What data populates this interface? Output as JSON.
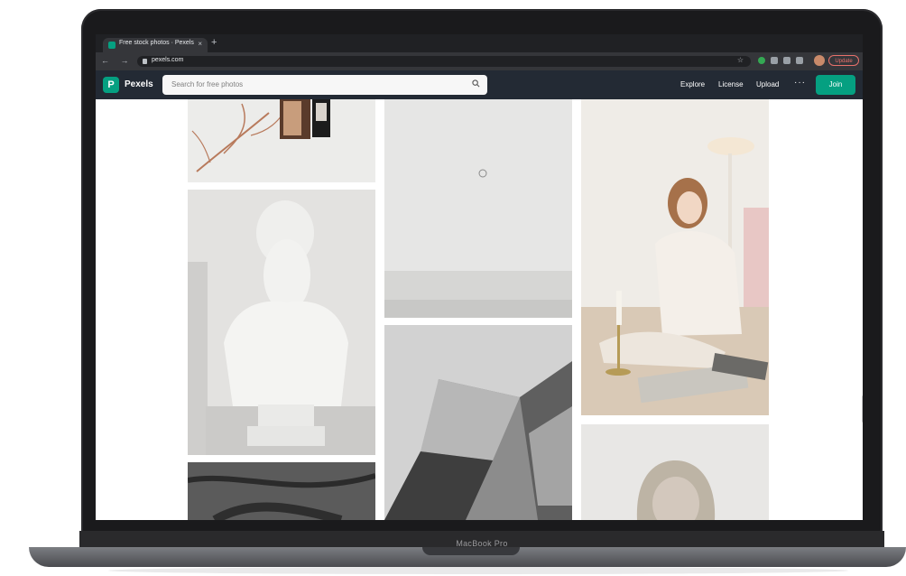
{
  "browser": {
    "tab_title": "Free stock photos · Pexels",
    "tab_close": "×",
    "new_tab": "+",
    "nav_arrows": "← → C",
    "url": "pexels.com",
    "bookmark_icon": "☆",
    "update_label": "Update"
  },
  "header": {
    "logo_letter": "P",
    "brand": "Pexels",
    "search_placeholder": "Search for free photos",
    "nav": [
      "Explore",
      "License",
      "Upload"
    ],
    "more": "···",
    "join": "Join"
  },
  "device": {
    "model": "MacBook Pro"
  },
  "colors": {
    "brand_green": "#05a081",
    "header_bg": "#232a34",
    "browser_bg": "#202124"
  },
  "icons": [
    "search-icon",
    "lock-icon",
    "star-icon",
    "close-icon",
    "chevron-left-icon",
    "chevron-right-icon",
    "reload-icon"
  ]
}
